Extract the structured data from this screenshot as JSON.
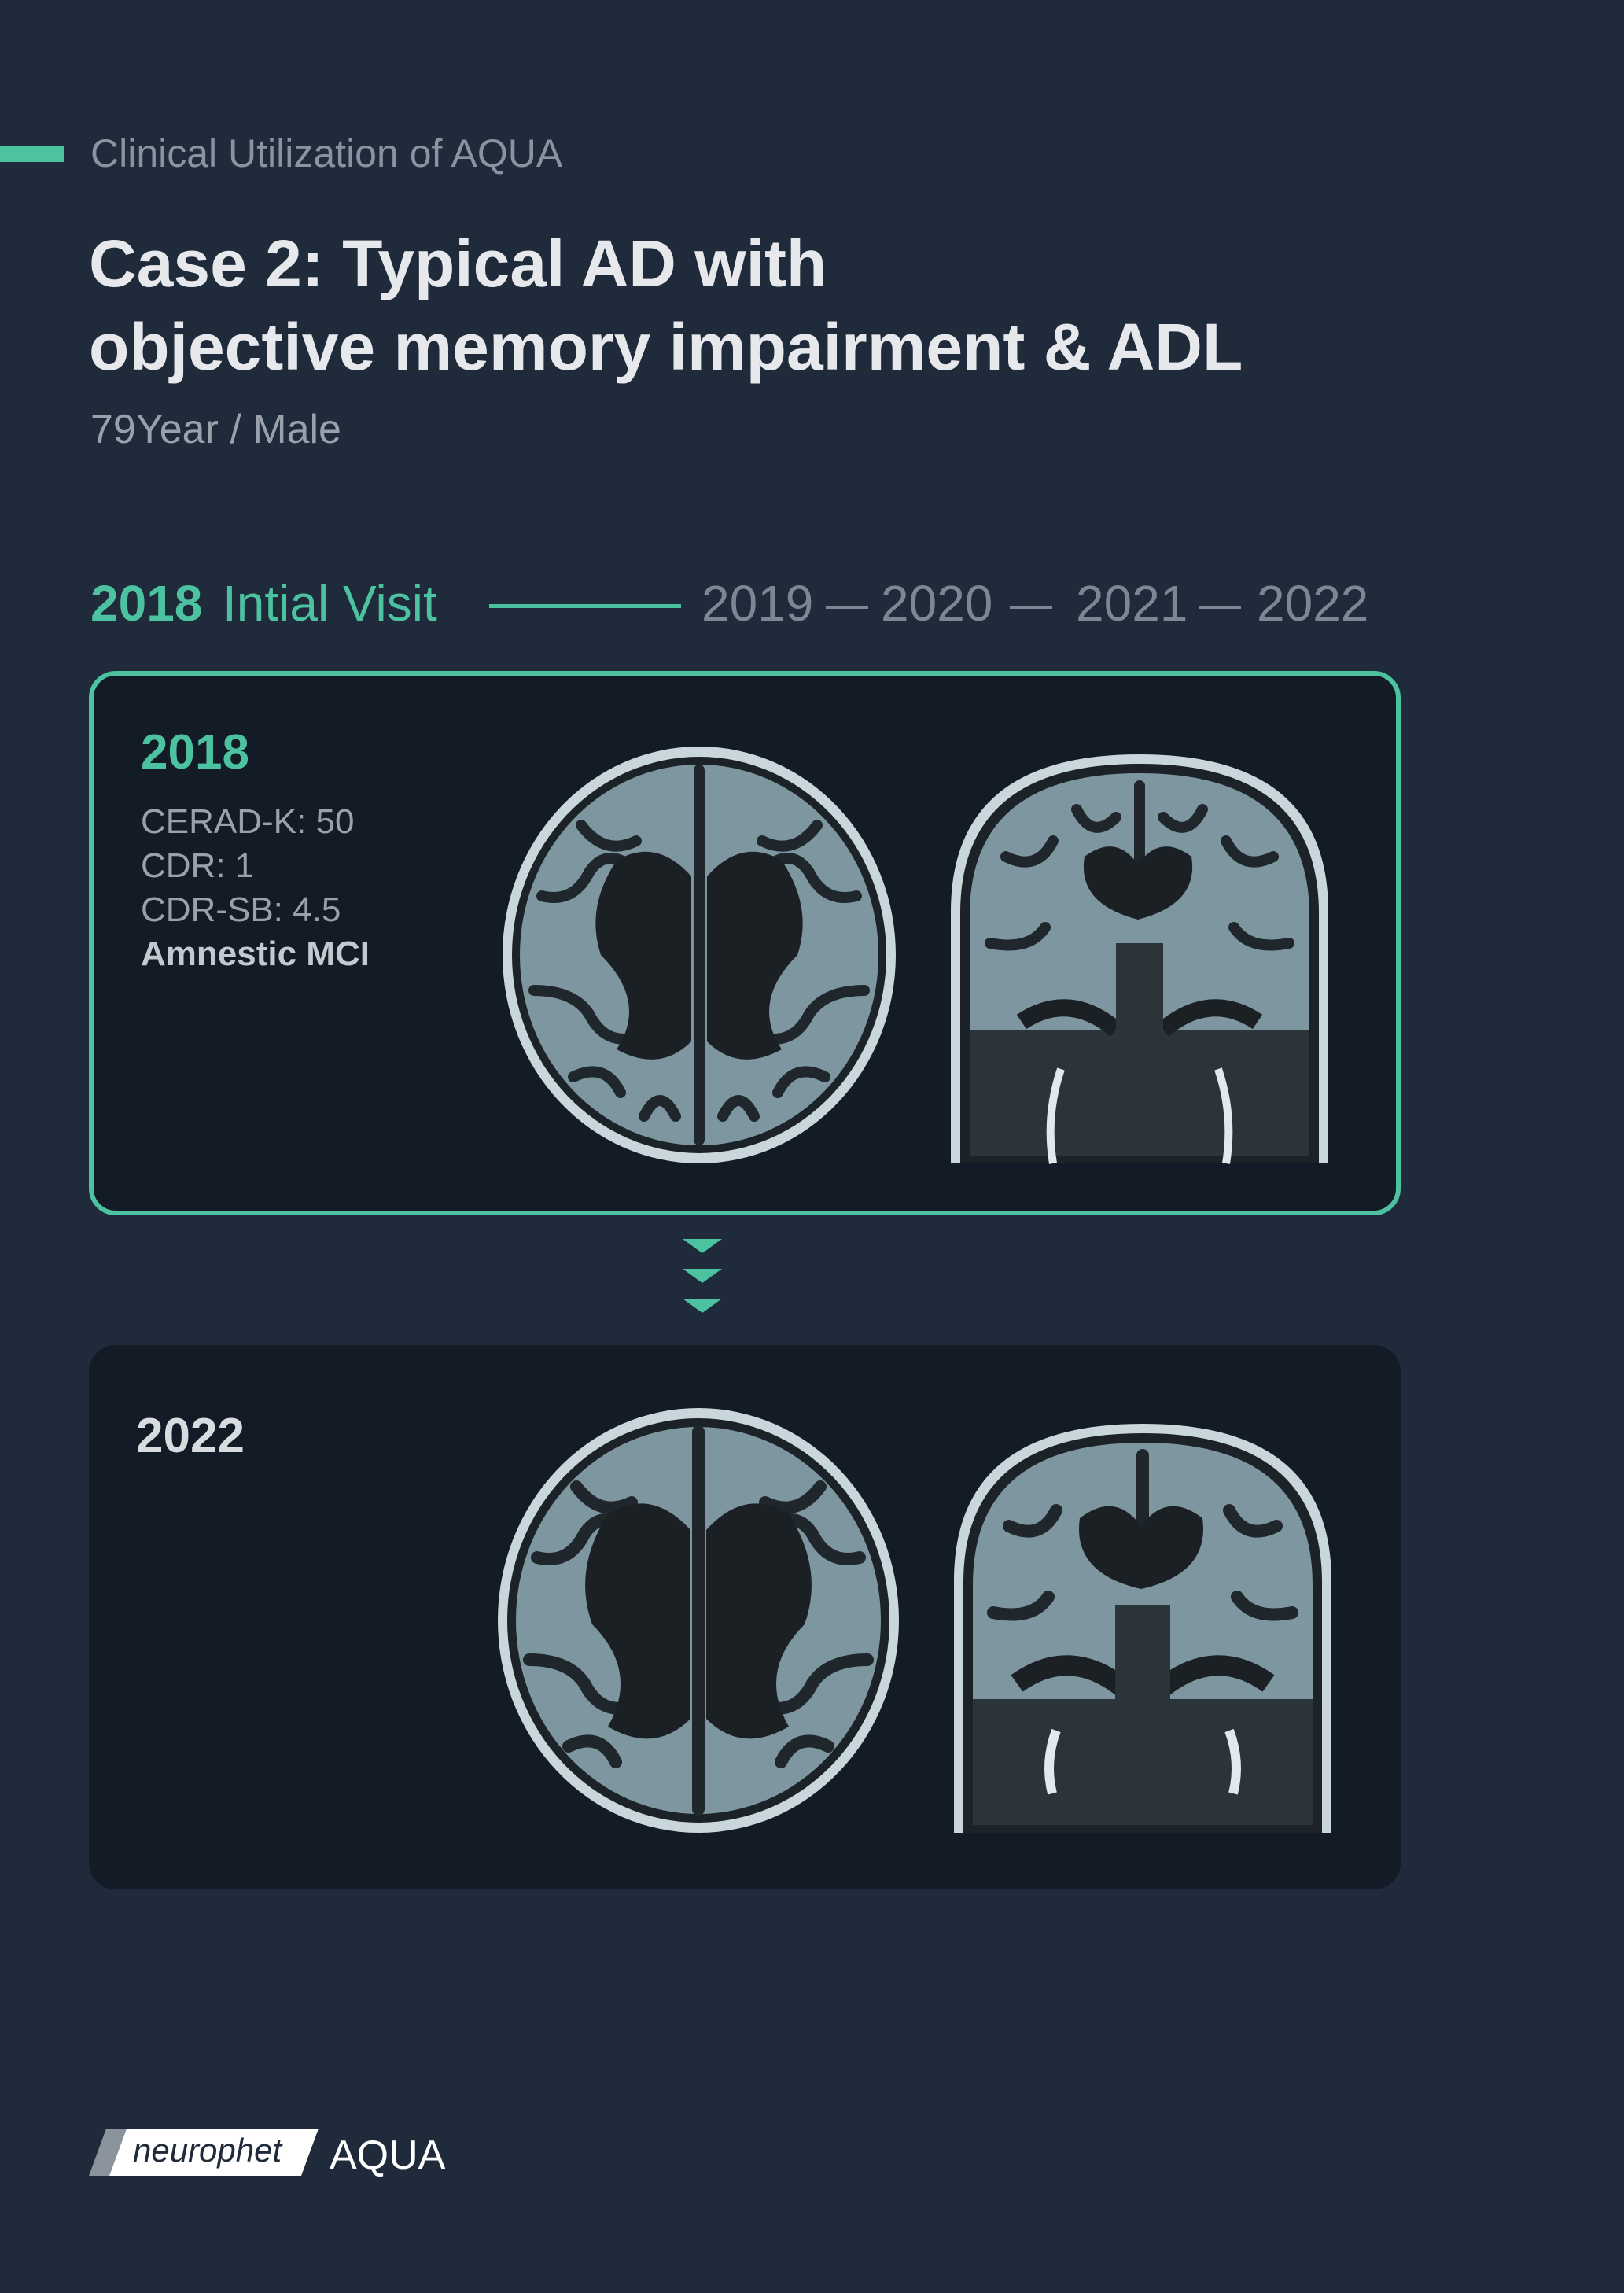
{
  "header": {
    "eyebrow": "Clinical Utilization of AQUA",
    "title_line1": "Case 2: Typical AD with",
    "title_line2": "objective memory impairment & ADL",
    "patient": "79Year / Male"
  },
  "timeline": {
    "active_year": "2018",
    "active_label": "Intial Visit",
    "years": [
      "2019",
      "2020",
      "2021",
      "2022"
    ]
  },
  "visit_2018": {
    "year": "2018",
    "metrics": [
      "CERAD-K: 50",
      "CDR: 1",
      "CDR-SB: 4.5"
    ],
    "diagnosis": "Amnestic MCI"
  },
  "visit_2022": {
    "year": "2022"
  },
  "footer": {
    "brand": "neurophet",
    "product": "AQUA"
  },
  "colors": {
    "background": "#1f2a3a",
    "accent": "#4dc2a0",
    "card": "#131b26"
  },
  "icons": [
    "axial-mri-scan",
    "coronal-mri-scan",
    "chevron-down-icon"
  ]
}
